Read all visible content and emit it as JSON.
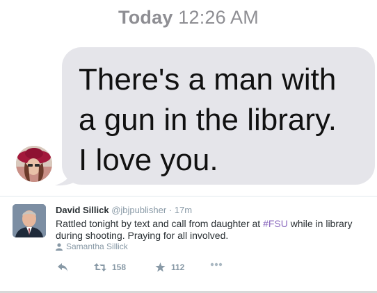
{
  "message": {
    "timestamp_day": "Today",
    "timestamp_time": "12:26 AM",
    "text": "There's a man with\na gun in the library.\nI love you."
  },
  "tweet": {
    "author_name": "David Sillick",
    "author_handle": "@jbjpublisher",
    "separator": "·",
    "time": "17m",
    "text_before": "Rattled tonight by text and call from daughter at ",
    "hashtag": "#FSU",
    "text_after": " while in library during shooting. Praying for all involved.",
    "retweeted_by": "Samantha Sillick",
    "retweet_count": "158",
    "favorite_count": "112"
  },
  "colors": {
    "bubble": "#e5e5ea",
    "meta": "#8899a6",
    "hashtag": "#8c6bbf"
  },
  "icons": {
    "reply": "reply-icon",
    "retweet": "retweet-icon",
    "favorite": "star-icon",
    "more": "more-icon",
    "person": "person-icon"
  }
}
